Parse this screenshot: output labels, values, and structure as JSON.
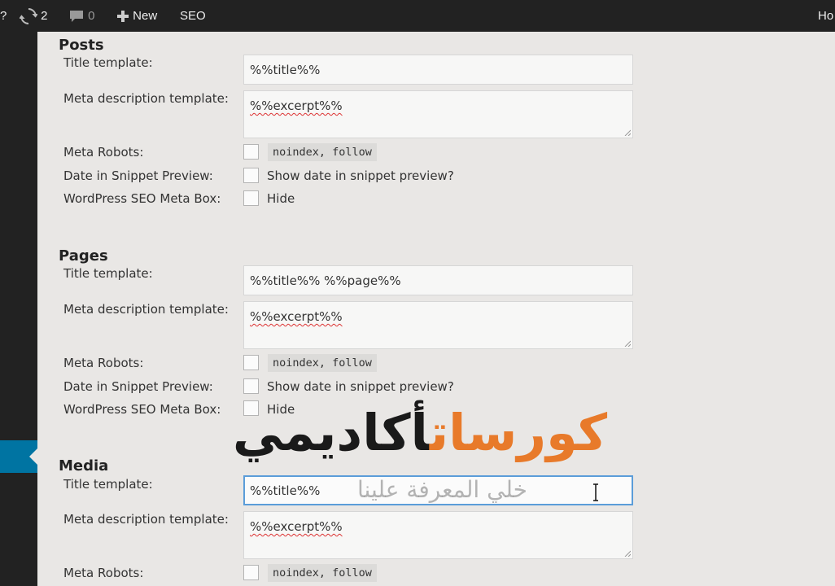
{
  "adminbar": {
    "help": "?",
    "updates_count": "2",
    "comments_count": "0",
    "new_label": "New",
    "seo_label": "SEO",
    "right_label": "Ho"
  },
  "sections": {
    "posts": {
      "title": "Posts",
      "title_template_label": "Title template:",
      "title_template_value": "%%title%%",
      "meta_desc_label": "Meta description template:",
      "meta_desc_value": "%%excerpt%%",
      "meta_robots_label": "Meta Robots:",
      "meta_robots_option": "noindex, follow",
      "date_label": "Date in Snippet Preview:",
      "date_option": "Show date in snippet preview?",
      "metabox_label": "WordPress SEO Meta Box:",
      "metabox_option": "Hide"
    },
    "pages": {
      "title": "Pages",
      "title_template_label": "Title template:",
      "title_template_value": "%%title%% %%page%%",
      "meta_desc_label": "Meta description template:",
      "meta_desc_value": "%%excerpt%%",
      "meta_robots_label": "Meta Robots:",
      "meta_robots_option": "noindex, follow",
      "date_label": "Date in Snippet Preview:",
      "date_option": "Show date in snippet preview?",
      "metabox_label": "WordPress SEO Meta Box:",
      "metabox_option": "Hide"
    },
    "media": {
      "title": "Media",
      "title_template_label": "Title template:",
      "title_template_value": "%%title%%",
      "meta_desc_label": "Meta description template:",
      "meta_desc_value": "%%excerpt%%",
      "meta_robots_label": "Meta Robots:",
      "meta_robots_option": "noindex, follow"
    }
  },
  "watermark": {
    "main_orange": "كورسات",
    "main_black": "أكاديمي",
    "tagline": "خلي المعرفة علينا"
  },
  "colors": {
    "adminbar_bg": "#222222",
    "accent_blue": "#0074a2",
    "watermark_orange": "#e87a2a",
    "focus_border": "#5b9dd9"
  }
}
